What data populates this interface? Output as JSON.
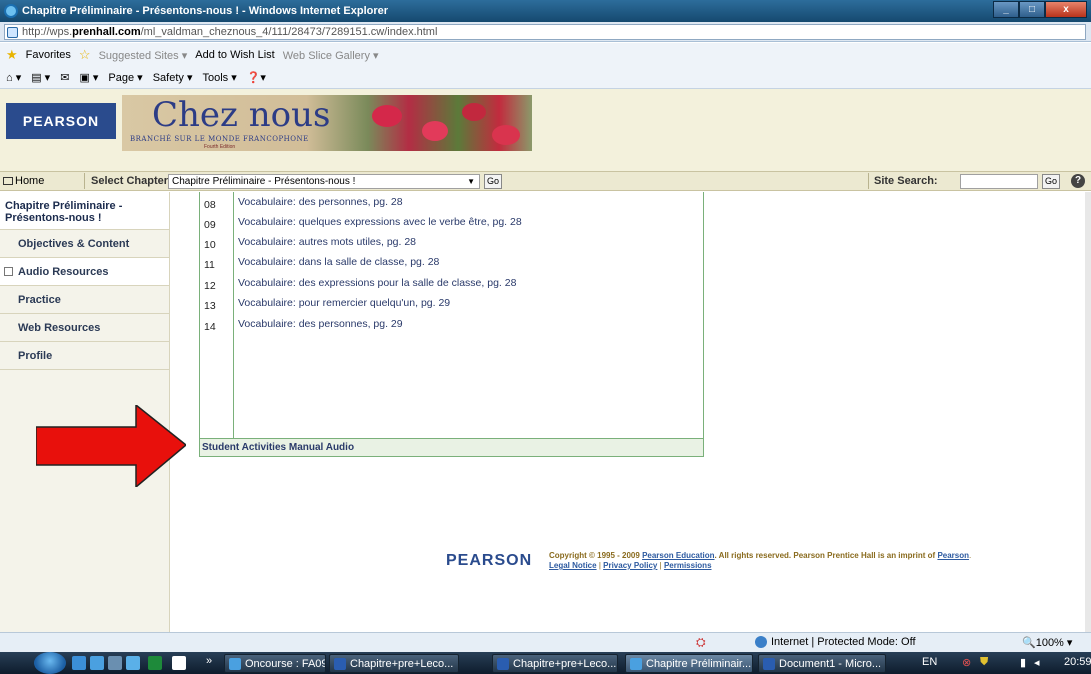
{
  "window": {
    "title": "Chapitre Préliminaire - Présentons-nous ! - Windows Internet Explorer",
    "controls": [
      "_",
      "□",
      "x"
    ]
  },
  "address": {
    "url_prefix": "http://wps.",
    "url_domain": "prenhall.com",
    "url_path": "/ml_valdman_cheznous_4/111/28473/7289151.cw/index.html"
  },
  "favorites_bar": {
    "favorites": "Favorites",
    "suggested": "Suggested Sites ▾",
    "wishlist": "Add to Wish List",
    "webslice": "Web Slice Gallery ▾"
  },
  "command_bar": {
    "page": "Page ▾",
    "safety": "Safety ▾",
    "tools": "Tools ▾",
    "help": "❓▾"
  },
  "header": {
    "logo": "PEARSON",
    "title": "Chez nous",
    "subtitle": "BRANCHÉ SUR LE MONDE FRANCOPHONE",
    "edition": "Fourth Edition"
  },
  "nav": {
    "home": "Home",
    "select_label": "Select Chapter:",
    "selected_chapter": "Chapitre Préliminaire - Présentons-nous !",
    "go": "Go",
    "site_search_label": "Site Search:",
    "search_value": "",
    "help": "?"
  },
  "sidebar": {
    "chapter_title": "Chapitre Préliminaire - Présentons-nous !",
    "items": [
      {
        "label": "Objectives & Content"
      },
      {
        "label": "Audio Resources"
      },
      {
        "label": "Practice"
      },
      {
        "label": "Web Resources"
      },
      {
        "label": "Profile"
      }
    ]
  },
  "audio_list": {
    "rows": [
      {
        "num": "08",
        "text": "Vocabulaire: des personnes, pg. 28"
      },
      {
        "num": "09",
        "text": "Vocabulaire: quelques expressions avec le verbe être, pg. 28"
      },
      {
        "num": "10",
        "text": "Vocabulaire: autres mots utiles, pg. 28"
      },
      {
        "num": "11",
        "text": "Vocabulaire: dans la salle de classe, pg. 28"
      },
      {
        "num": "12",
        "text": "Vocabulaire: des expressions pour la salle de classe, pg. 28"
      },
      {
        "num": "13",
        "text": "Vocabulaire: pour remercier quelqu'un, pg. 29"
      },
      {
        "num": "14",
        "text": "Vocabulaire: des personnes, pg. 29"
      }
    ],
    "footer": "Student Activities Manual Audio"
  },
  "footer": {
    "logo": "PEARSON",
    "copyright_prefix": "Copyright © 1995 - 2009",
    "link_pearson_education": "Pearson Education",
    "copyright_mid": ". All rights reserved. Pearson Prentice Hall is an imprint of",
    "link_pearson": "Pearson",
    "period": ".",
    "link_legal": "Legal Notice",
    "link_privacy": "Privacy Policy",
    "link_permissions": "Permissions",
    "pipe": "|"
  },
  "status_bar": {
    "zone": "Internet | Protected Mode: Off",
    "zoom": "100%"
  },
  "taskbar": {
    "tasks": [
      {
        "label": "Oncourse : FA09 BL ..."
      },
      {
        "label": "Chapitre+pre+Leco..."
      },
      {
        "label": "Chapitre+pre+Leco..."
      },
      {
        "label": "Chapitre Préliminair..."
      },
      {
        "label": "Document1 - Micro..."
      }
    ],
    "more": "»",
    "lang": "EN",
    "clock": "20:59"
  },
  "colors": {
    "accent_red_arrow": "#e8100c",
    "list_border": "#7ab07a",
    "pearson_blue": "#2a4b8d"
  }
}
